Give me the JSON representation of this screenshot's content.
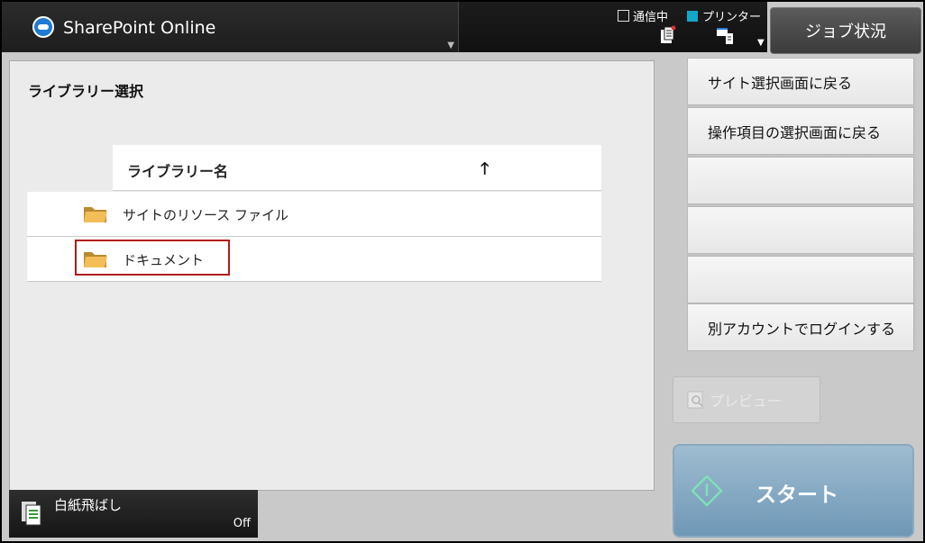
{
  "header": {
    "app_title": "SharePoint Online",
    "status_comm": "通信中",
    "status_printer": "プリンター",
    "job_status": "ジョブ状況"
  },
  "main": {
    "page_title": "ライブラリー選択",
    "column_header": "ライブラリー名",
    "rows": [
      {
        "label": "サイトのリソース ファイル"
      },
      {
        "label": "ドキュメント"
      }
    ]
  },
  "side_menu": {
    "items": [
      {
        "label": "サイト選択画面に戻る"
      },
      {
        "label": "操作項目の選択画面に戻る"
      },
      {
        "label": ""
      },
      {
        "label": ""
      },
      {
        "label": ""
      },
      {
        "label": "別アカウントでログインする"
      }
    ]
  },
  "preview": {
    "label": "プレビュー"
  },
  "start": {
    "label": "スタート"
  },
  "blank_skip": {
    "label": "白紙飛ばし",
    "value": "Off"
  },
  "colors": {
    "accent_status": "#11a7c9",
    "selection": "#b11b1b",
    "start_button": "#7fa4bf"
  }
}
